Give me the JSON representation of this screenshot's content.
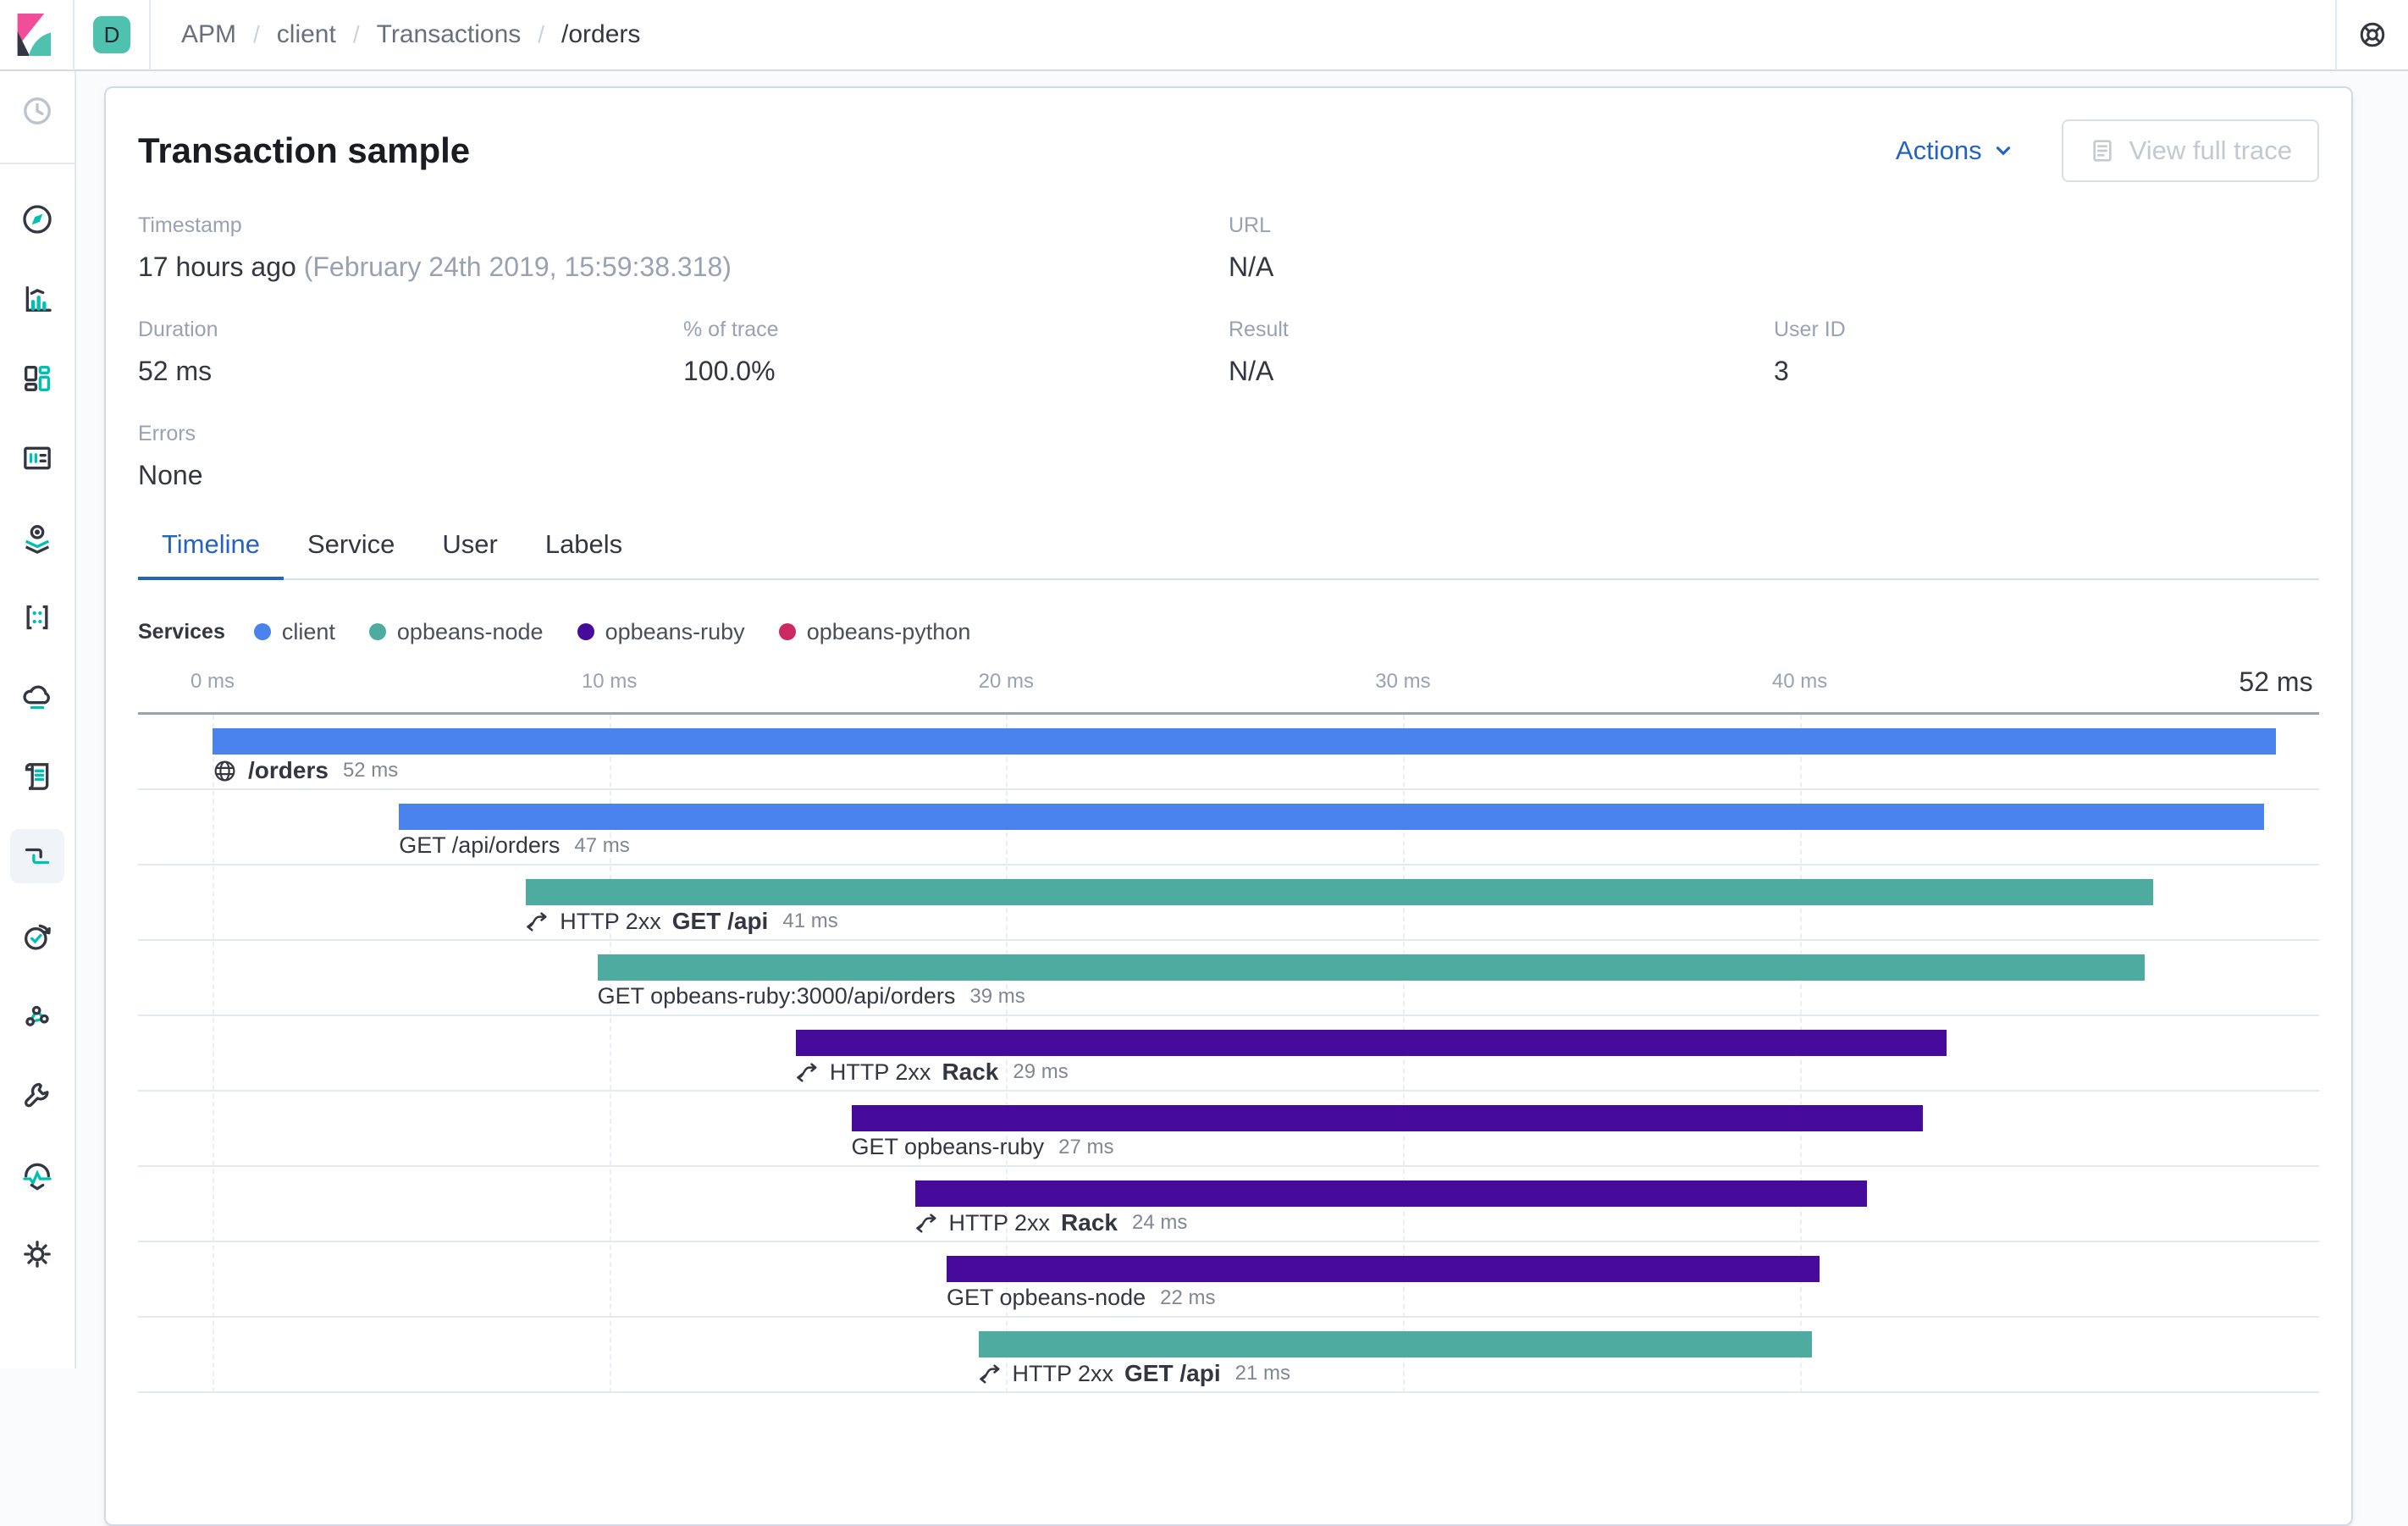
{
  "topbar": {
    "space_badge": "D",
    "breadcrumb": [
      {
        "label": "APM",
        "active": false
      },
      {
        "label": "client",
        "active": false
      },
      {
        "label": "Transactions",
        "active": false
      },
      {
        "label": "/orders",
        "active": true
      }
    ],
    "help_icon": "help-icon"
  },
  "sidebar": {
    "items": [
      "recent",
      "discover",
      "visualize",
      "dashboard",
      "canvas",
      "maps",
      "machine-learning",
      "infrastructure",
      "logs",
      "apm",
      "uptime",
      "graph",
      "dev-tools",
      "stack-monitoring",
      "management"
    ],
    "active_item": "apm"
  },
  "panel": {
    "title": "Transaction sample",
    "actions_label": "Actions",
    "view_full_trace_label": "View full trace",
    "field_rows": [
      [
        {
          "label": "Timestamp",
          "value": "17 hours ago",
          "secondary": "(February 24th 2019, 15:59:38.318)",
          "col": 1,
          "span": 2
        },
        {
          "label": "URL",
          "value": "N/A",
          "col": 3,
          "span": 2
        }
      ],
      [
        {
          "label": "Duration",
          "value": "52 ms",
          "col": 1
        },
        {
          "label": "% of trace",
          "value": "100.0%",
          "col": 2
        },
        {
          "label": "Result",
          "value": "N/A",
          "col": 3
        },
        {
          "label": "User ID",
          "value": "3",
          "col": 4
        }
      ],
      [
        {
          "label": "Errors",
          "value": "None",
          "col": 1
        }
      ]
    ],
    "tabs": [
      {
        "label": "Timeline",
        "active": true
      },
      {
        "label": "Service",
        "active": false
      },
      {
        "label": "User",
        "active": false
      },
      {
        "label": "Labels",
        "active": false
      }
    ],
    "legend": {
      "title": "Services",
      "items": [
        {
          "label": "client",
          "service": "client"
        },
        {
          "label": "opbeans-node",
          "service": "opbeans-node"
        },
        {
          "label": "opbeans-ruby",
          "service": "opbeans-ruby"
        },
        {
          "label": "opbeans-python",
          "service": "opbeans-python"
        }
      ]
    },
    "axis": {
      "ticks": [
        {
          "label": "0 ms",
          "ms": 0
        },
        {
          "label": "10 ms",
          "ms": 10
        },
        {
          "label": "20 ms",
          "ms": 20
        },
        {
          "label": "30 ms",
          "ms": 30
        },
        {
          "label": "40 ms",
          "ms": 40
        }
      ],
      "total": {
        "label": "52 ms",
        "ms": 52
      },
      "total_ms": 52
    },
    "waterfall": {
      "rows": [
        {
          "type": "transaction",
          "icon": "globe",
          "prefix": "",
          "name": "/orders",
          "duration_label": "52 ms",
          "service": "client",
          "offset_ms": 0,
          "duration_ms": 52
        },
        {
          "type": "span",
          "icon": "",
          "prefix": "",
          "name": "GET /api/orders",
          "duration_label": "47 ms",
          "service": "client",
          "offset_ms": 4.7,
          "duration_ms": 47
        },
        {
          "type": "transaction",
          "icon": "merge",
          "prefix": "HTTP 2xx",
          "name": "GET /api",
          "duration_label": "41 ms",
          "service": "opbeans-node",
          "offset_ms": 7.9,
          "duration_ms": 41
        },
        {
          "type": "span",
          "icon": "",
          "prefix": "",
          "name": "GET opbeans-ruby:3000/api/orders",
          "duration_label": "39 ms",
          "service": "opbeans-node",
          "offset_ms": 9.7,
          "duration_ms": 39
        },
        {
          "type": "transaction",
          "icon": "merge",
          "prefix": "HTTP 2xx",
          "name": "Rack",
          "duration_label": "29 ms",
          "service": "opbeans-ruby",
          "offset_ms": 14.7,
          "duration_ms": 29
        },
        {
          "type": "span",
          "icon": "",
          "prefix": "",
          "name": "GET opbeans-ruby",
          "duration_label": "27 ms",
          "service": "opbeans-ruby",
          "offset_ms": 16.1,
          "duration_ms": 27
        },
        {
          "type": "transaction",
          "icon": "merge",
          "prefix": "HTTP 2xx",
          "name": "Rack",
          "duration_label": "24 ms",
          "service": "opbeans-ruby",
          "offset_ms": 17.7,
          "duration_ms": 24
        },
        {
          "type": "span",
          "icon": "",
          "prefix": "",
          "name": "GET opbeans-node",
          "duration_label": "22 ms",
          "service": "opbeans-ruby",
          "offset_ms": 18.5,
          "duration_ms": 22
        },
        {
          "type": "transaction",
          "icon": "merge",
          "prefix": "HTTP 2xx",
          "name": "GET /api",
          "duration_label": "21 ms",
          "service": "opbeans-node",
          "offset_ms": 19.3,
          "duration_ms": 21
        }
      ]
    }
  },
  "colors": {
    "service_colors": {
      "client": "#4A82EE",
      "opbeans-node": "#4DAB9F",
      "opbeans-ruby": "#470B9B",
      "opbeans-python": "#CB2964"
    },
    "accent_blue": "#2563C2"
  }
}
